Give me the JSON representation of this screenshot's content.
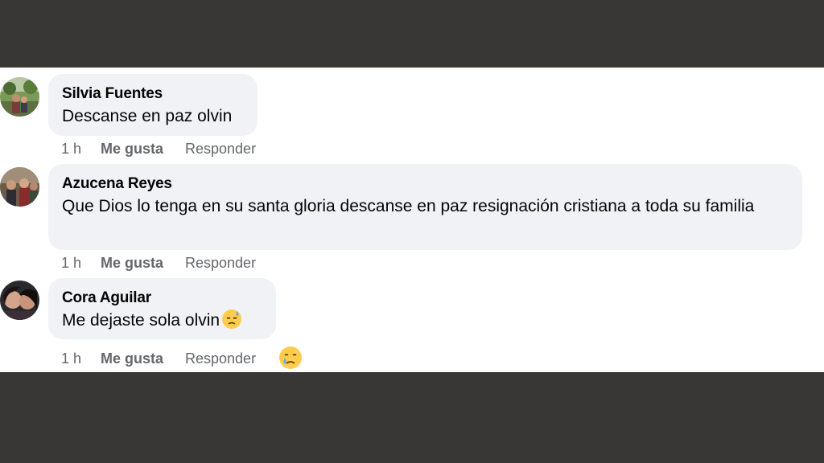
{
  "comments": [
    {
      "author": "Silvia Fuentes",
      "text": "Descanse en paz olvin",
      "time": "1 h",
      "like_label": "Me gusta",
      "reply_label": "Responder"
    },
    {
      "author": "Azucena Reyes",
      "text": "Que Dios lo tenga en su santa gloria descanse en paz resignación cristiana a toda su familia",
      "time": "1 h",
      "like_label": "Me gusta",
      "reply_label": "Responder"
    },
    {
      "author": "Cora Aguilar",
      "text": "Me dejaste sola olvin",
      "time": "1 h",
      "like_label": "Me gusta",
      "reply_label": "Responder",
      "inline_emoji": "downcast-face-with-sweat-icon",
      "reaction_emoji": "crying-face-icon"
    }
  ],
  "colors": {
    "frame": "#383735",
    "bubble": "#f0f2f5",
    "meta_text": "#65676b",
    "emoji_yellow": "#ffcc4d"
  }
}
